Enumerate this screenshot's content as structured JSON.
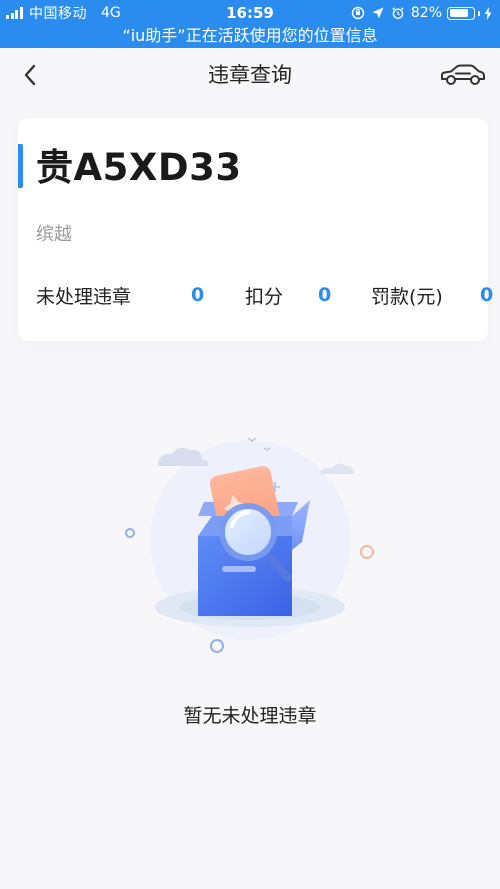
{
  "status_bar": {
    "carrier": "中国移动",
    "network": "4G",
    "time": "16:59",
    "battery_percent": "82%",
    "battery_level": 0.82,
    "location_banner": "“iu助手”正在活跃使用您的位置信息"
  },
  "nav": {
    "title": "违章查询",
    "back_icon": "chevron-left-icon",
    "car_icon": "car-icon"
  },
  "vehicle": {
    "plate": "贵A5XD33",
    "model": "缤越",
    "stats": [
      {
        "label": "未处理违章",
        "value": "0"
      },
      {
        "label": "扣分",
        "value": "0"
      },
      {
        "label": "罚款(元)",
        "value": "0"
      }
    ]
  },
  "empty_state": {
    "message": "暂无未处理违章",
    "illustration": "empty-box-magnifier-illustration"
  },
  "colors": {
    "status_bar_bg": "#2b8cf0",
    "accent": "#2b8cf0",
    "page_bg": "#f7f7f9",
    "card_bg": "#ffffff",
    "muted_text": "#9a9a9a"
  }
}
